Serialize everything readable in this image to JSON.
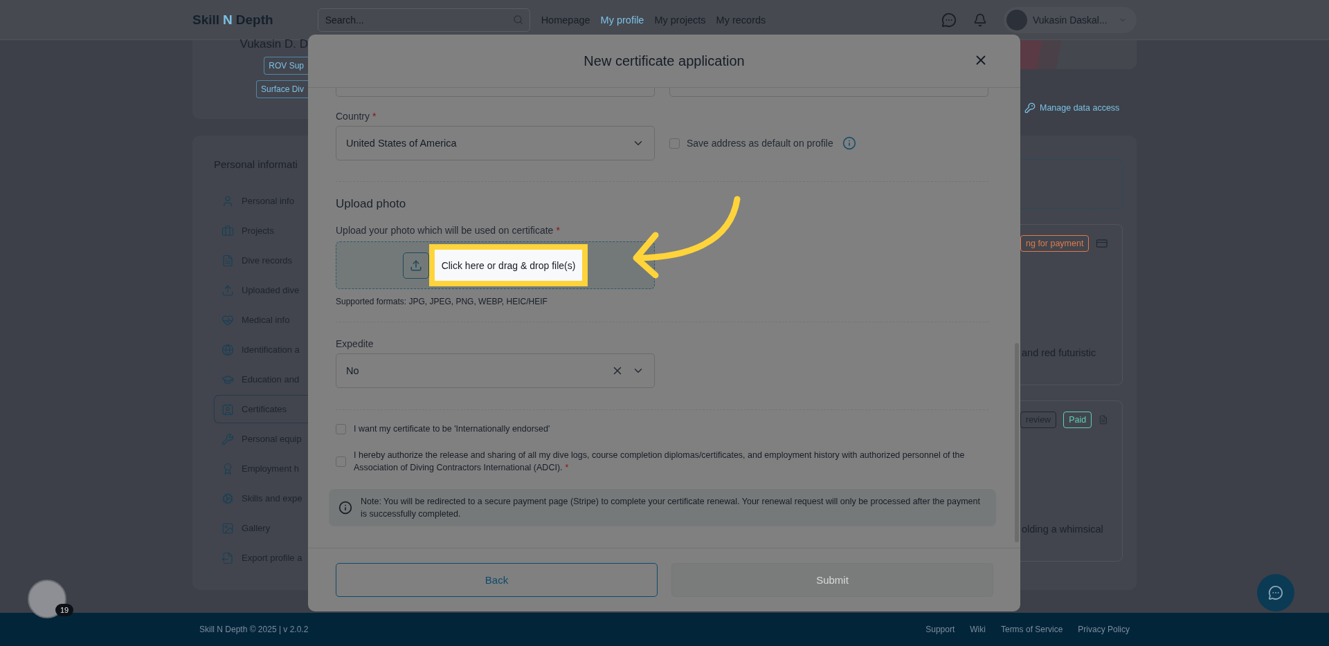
{
  "header": {
    "logo": {
      "before": "Skill",
      "accent": "N",
      "after": "Depth"
    },
    "search": {
      "placeholder": "Search..."
    },
    "nav": [
      {
        "label": "Homepage",
        "selected": false
      },
      {
        "label": "My profile",
        "selected": true
      },
      {
        "label": "My projects",
        "selected": false
      },
      {
        "label": "My records",
        "selected": false
      }
    ],
    "user": {
      "name": "Vukasin Daskal..."
    }
  },
  "profile_card": {
    "name": "Vukasin D. D",
    "tags": [
      "ROV Sup",
      "Surface Div"
    ]
  },
  "sidebar": {
    "title": "Personal informati",
    "items": [
      {
        "label": "Personal info",
        "selected": false
      },
      {
        "label": "Projects",
        "selected": false
      },
      {
        "label": "Dive records",
        "selected": false
      },
      {
        "label": "Uploaded dive",
        "selected": false
      },
      {
        "label": "Medical info",
        "selected": false
      },
      {
        "label": "Identification a",
        "selected": false
      },
      {
        "label": "Education and",
        "selected": false
      },
      {
        "label": "Certificates",
        "selected": true
      },
      {
        "label": "Personal equip",
        "selected": false
      },
      {
        "label": "Employment h",
        "selected": false
      },
      {
        "label": "Skills and expe",
        "selected": false
      },
      {
        "label": "Gallery",
        "selected": false
      },
      {
        "label": "Export profile a",
        "selected": false
      }
    ]
  },
  "right_panel": {
    "link": "Manage data access",
    "cards": [
      {
        "badges": [
          {
            "label": "ng for payment",
            "kind": "warning"
          }
        ],
        "text": "and red futuristic"
      },
      {
        "badges": [
          {
            "label": "review",
            "kind": "neutral"
          },
          {
            "label": "Paid",
            "kind": "success"
          }
        ],
        "text": "olding a whimsical"
      }
    ]
  },
  "modal": {
    "title": "New certificate application",
    "country": {
      "label": "Country",
      "required_mark": "*",
      "value": "United States of America"
    },
    "save_default": {
      "label": "Save address as default on profile",
      "checked": false
    },
    "upload": {
      "title": "Upload photo",
      "label": "Upload your photo which will be used on certificate",
      "required_mark": "*",
      "prompt": "Click here or drag & drop file(s)",
      "formats": "Supported formats: JPG, JPEG, PNG, WEBP, HEIC/HEIF"
    },
    "expedite": {
      "label": "Expedite",
      "value": "No"
    },
    "checkboxes": [
      {
        "label": "I want my certificate to be 'Internationally endorsed'",
        "checked": false
      },
      {
        "label": "I hereby authorize the release and sharing of all my dive logs, course completion diplomas/certificates, and employment history with authorized personnel of the Association of Diving Contractors International (ADCI).",
        "required_mark": "*",
        "checked": false
      }
    ],
    "note": "Note: You will be redirected to a secure payment page (Stripe) to complete your certificate renewal. Your renewal request will only be processed after the payment is successfully completed.",
    "buttons": [
      {
        "label": "Back",
        "kind": "secondary",
        "disabled": false
      },
      {
        "label": "Submit",
        "kind": "primary",
        "disabled": true
      }
    ]
  },
  "footer": {
    "copyright": "Skill N Depth © 2025 | v 2.0.2",
    "links": [
      "Support",
      "Wiki",
      "Terms of Service",
      "Privacy Policy"
    ]
  },
  "floating": {
    "badge": "19"
  }
}
